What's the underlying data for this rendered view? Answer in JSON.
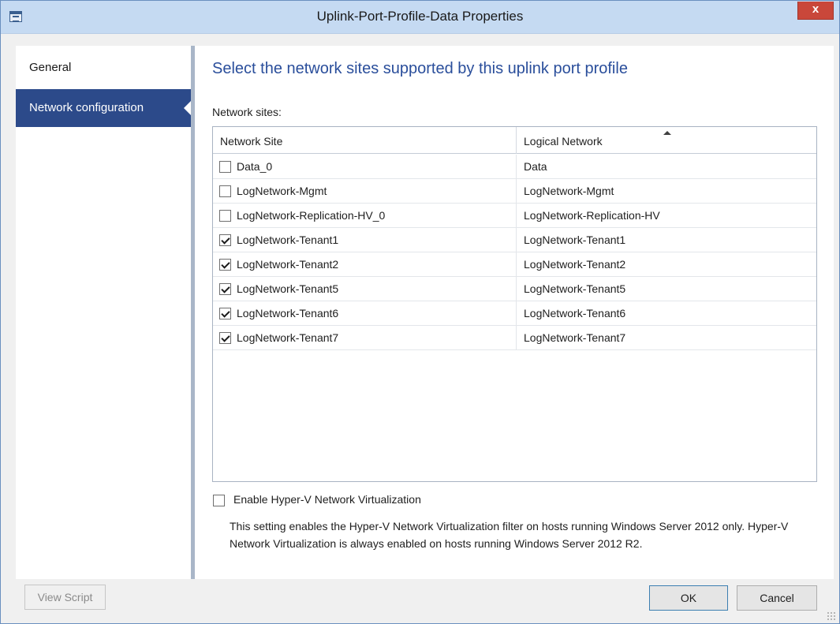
{
  "window": {
    "title": "Uplink-Port-Profile-Data Properties",
    "close_label": "x"
  },
  "nav": {
    "items": [
      {
        "label": "General",
        "active": false
      },
      {
        "label": "Network configuration",
        "active": true
      }
    ]
  },
  "main": {
    "heading": "Select the network sites supported by this uplink port profile",
    "sites_label": "Network sites:",
    "columns": {
      "site": "Network Site",
      "logical": "Logical Network",
      "sort_icon": "sort-ascending-icon"
    },
    "rows": [
      {
        "site": "Data_0",
        "logical": "Data",
        "checked": false
      },
      {
        "site": "LogNetwork-Mgmt",
        "logical": "LogNetwork-Mgmt",
        "checked": false
      },
      {
        "site": "LogNetwork-Replication-HV_0",
        "logical": "LogNetwork-Replication-HV",
        "checked": false
      },
      {
        "site": "LogNetwork-Tenant1",
        "logical": "LogNetwork-Tenant1",
        "checked": true
      },
      {
        "site": "LogNetwork-Tenant2",
        "logical": "LogNetwork-Tenant2",
        "checked": true
      },
      {
        "site": "LogNetwork-Tenant5",
        "logical": "LogNetwork-Tenant5",
        "checked": true
      },
      {
        "site": "LogNetwork-Tenant6",
        "logical": "LogNetwork-Tenant6",
        "checked": true
      },
      {
        "site": "LogNetwork-Tenant7",
        "logical": "LogNetwork-Tenant7",
        "checked": true
      }
    ],
    "hyperv": {
      "label": "Enable Hyper-V Network Virtualization",
      "checked": false,
      "description": "This setting enables the Hyper-V Network Virtualization filter on hosts running Windows Server 2012 only. Hyper-V Network Virtualization is always enabled on hosts running Windows Server 2012 R2."
    }
  },
  "footer": {
    "view_script": "View Script",
    "ok": "OK",
    "cancel": "Cancel"
  },
  "colors": {
    "titlebar": "#c5daf2",
    "nav_active": "#2c4a8a",
    "heading": "#2a4e9b",
    "close": "#c9473a"
  }
}
